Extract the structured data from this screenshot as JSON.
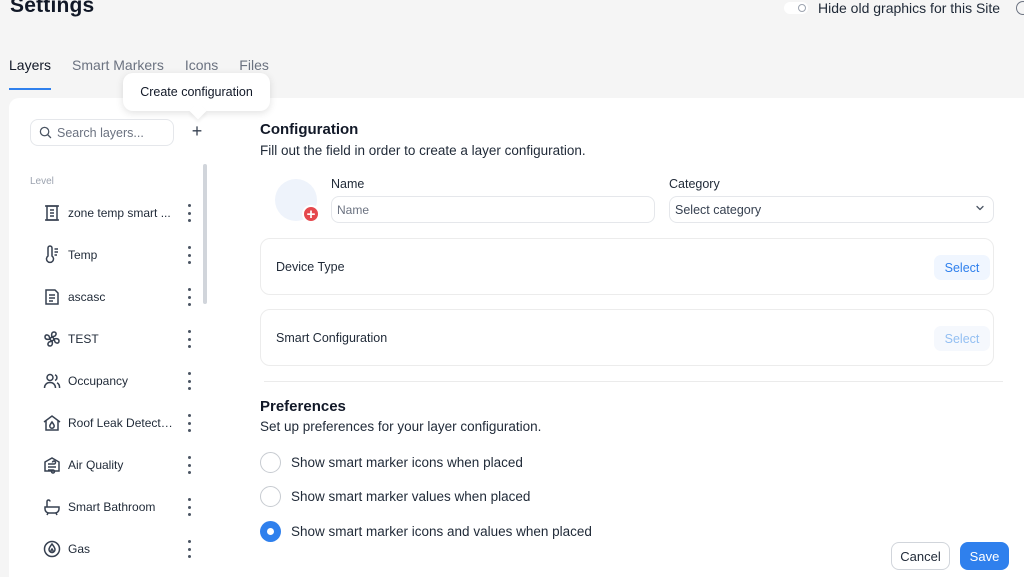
{
  "header": {
    "title": "Settings",
    "toggle_label": "Hide old graphics for this Site"
  },
  "tabs": [
    {
      "label": "Layers",
      "active": true
    },
    {
      "label": "Smart Markers",
      "active": false
    },
    {
      "label": "Icons",
      "active": false
    },
    {
      "label": "Files",
      "active": false
    }
  ],
  "sidebar": {
    "search_placeholder": "Search layers...",
    "tooltip": "Create configuration",
    "level_label": "Level",
    "items": [
      {
        "label": "zone temp smart ...",
        "icon": "building-icon"
      },
      {
        "label": "Temp",
        "icon": "thermometer-icon"
      },
      {
        "label": "ascasc",
        "icon": "document-icon"
      },
      {
        "label": "TEST",
        "icon": "fan-icon"
      },
      {
        "label": "Occupancy",
        "icon": "users-icon"
      },
      {
        "label": "Roof Leak Detecti...",
        "icon": "house-drop-icon"
      },
      {
        "label": "Air Quality",
        "icon": "air-quality-icon"
      },
      {
        "label": "Smart Bathroom",
        "icon": "bathtub-icon"
      },
      {
        "label": "Gas",
        "icon": "gas-flame-icon"
      }
    ]
  },
  "configuration": {
    "title": "Configuration",
    "subtitle": "Fill out the field in order to create a layer configuration.",
    "name_label": "Name",
    "name_placeholder": "Name",
    "category_label": "Category",
    "category_placeholder": "Select category",
    "device_type_label": "Device Type",
    "device_type_button": "Select",
    "smart_config_label": "Smart Configuration",
    "smart_config_button": "Select"
  },
  "preferences": {
    "title": "Preferences",
    "subtitle": "Set up preferences for your layer configuration.",
    "options": [
      {
        "label": "Show smart marker icons when placed",
        "checked": false
      },
      {
        "label": "Show smart marker values when placed",
        "checked": false
      },
      {
        "label": "Show smart marker icons and values when placed",
        "checked": true
      }
    ]
  },
  "footer": {
    "cancel_label": "Cancel",
    "save_label": "Save"
  },
  "colors": {
    "accent": "#2f80ed",
    "danger": "#e5484d"
  }
}
